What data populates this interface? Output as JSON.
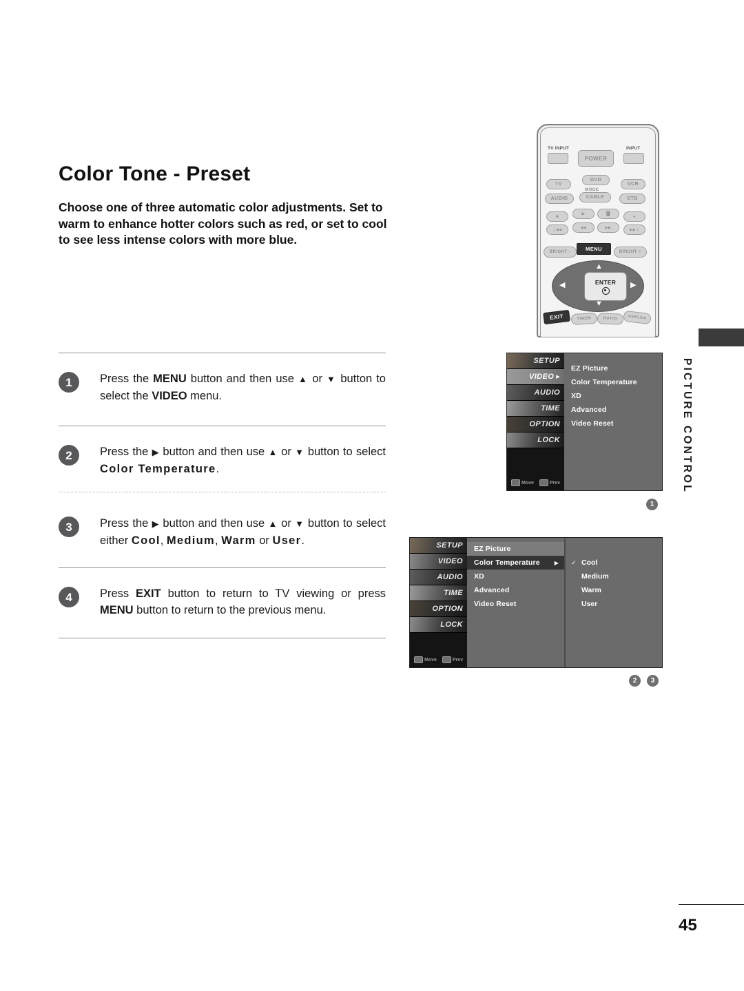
{
  "page": {
    "title": "Color Tone - Preset",
    "intro": "Choose one of three automatic color adjustments. Set to warm to enhance hotter colors such as red, or set to cool to see less intense colors with more blue.",
    "number": "45",
    "side_tab_label": "PICTURE CONTROL"
  },
  "steps": [
    {
      "num": "1",
      "html": "Press the <b>MENU</b> button and then use <span class=\"arrowglyph\">&#9650;</span> or <span class=\"arrowglyph\">&#9660;</span> button to select the <b>VIDEO</b> menu."
    },
    {
      "num": "2",
      "html": "Press the <span class=\"arrowglyph\">&#9654;</span> button and then use <span class=\"arrowglyph\">&#9650;</span> or <span class=\"arrowglyph\">&#9660;</span> button to select <span class=\"sp\">Color Temperature</span>."
    },
    {
      "num": "3",
      "html": "Press the <span class=\"arrowglyph\">&#9654;</span> button and then use <span class=\"arrowglyph\">&#9650;</span> or <span class=\"arrowglyph\">&#9660;</span> button to select either <span class=\"sp\">Cool</span>, <span class=\"sp\">Medium</span>, <span class=\"sp\">Warm</span> or <span class=\"sp\">User</span>."
    },
    {
      "num": "4",
      "html": "Press <b>EXIT</b> button to return to TV viewing or press <b>MENU</b> button to return to the previous menu."
    }
  ],
  "remote": {
    "labels": {
      "tv_input": "TV INPUT",
      "input": "INPUT",
      "power": "POWER",
      "mode": "MODE"
    },
    "mode_row1": [
      "TV",
      "DVD",
      "VCR"
    ],
    "mode_row2": [
      "AUDIO",
      "CABLE",
      "STB"
    ],
    "transport_row1": [
      "■",
      "▶",
      "▐▌",
      "●"
    ],
    "transport_row2": [
      "❘◀◀",
      "◀◀",
      "▶▶",
      "▶▶❘"
    ],
    "bright_minus": "BRIGHT -",
    "bright_plus": "BRIGHT +",
    "menu": "MENU",
    "enter": "ENTER",
    "exit": "EXIT",
    "bottom_row": [
      "TIMER",
      "RATIO",
      "SIMPLINK"
    ]
  },
  "osd_common": {
    "sidebar": [
      "SETUP",
      "VIDEO",
      "AUDIO",
      "TIME",
      "OPTION",
      "LOCK"
    ],
    "menu_items": [
      "EZ Picture",
      "Color Temperature",
      "XD",
      "Advanced",
      "Video Reset"
    ],
    "footer": {
      "move": "Move",
      "prev": "Prev"
    }
  },
  "osd1": {
    "selected_sidebar": "VIDEO",
    "badge": "1"
  },
  "osd2": {
    "highlighted_item": "EZ Picture",
    "selected_item": "Color Temperature",
    "submenu": [
      "Cool",
      "Medium",
      "Warm",
      "User"
    ],
    "checked": "Cool",
    "badges": [
      "2",
      "3"
    ]
  }
}
